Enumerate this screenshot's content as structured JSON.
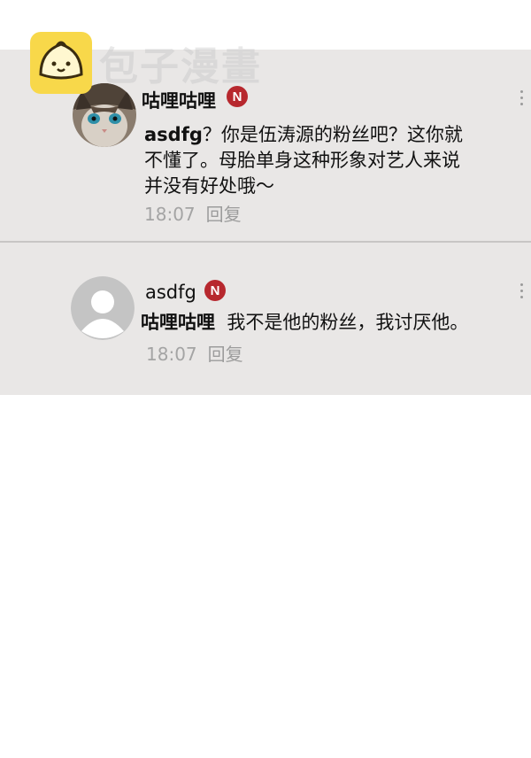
{
  "watermark": {
    "text": "包子漫畫",
    "logo_icon": "bun-logo-icon"
  },
  "comments": [
    {
      "username": "咕哩咕哩",
      "badge": "N",
      "mention": "asdfg",
      "text_line1": "？你是伍涛源的粉丝吧？这你就",
      "text_line2": "不懂了。母胎单身这种形象对艺人来说",
      "text_line3": "并没有好处哦～",
      "time": "18:07",
      "reply_label": "回复",
      "avatar_icon": "cat-avatar-icon"
    },
    {
      "username": "asdfg",
      "badge": "N",
      "mention": "咕哩咕哩",
      "text": "我不是他的粉丝，我讨厌他。",
      "time": "18:07",
      "reply_label": "回复",
      "avatar_icon": "default-user-avatar-icon"
    }
  ],
  "colors": {
    "badge": "#b7282e",
    "block_bg": "#e9e7e6",
    "logo_bg": "#f8d84a"
  }
}
